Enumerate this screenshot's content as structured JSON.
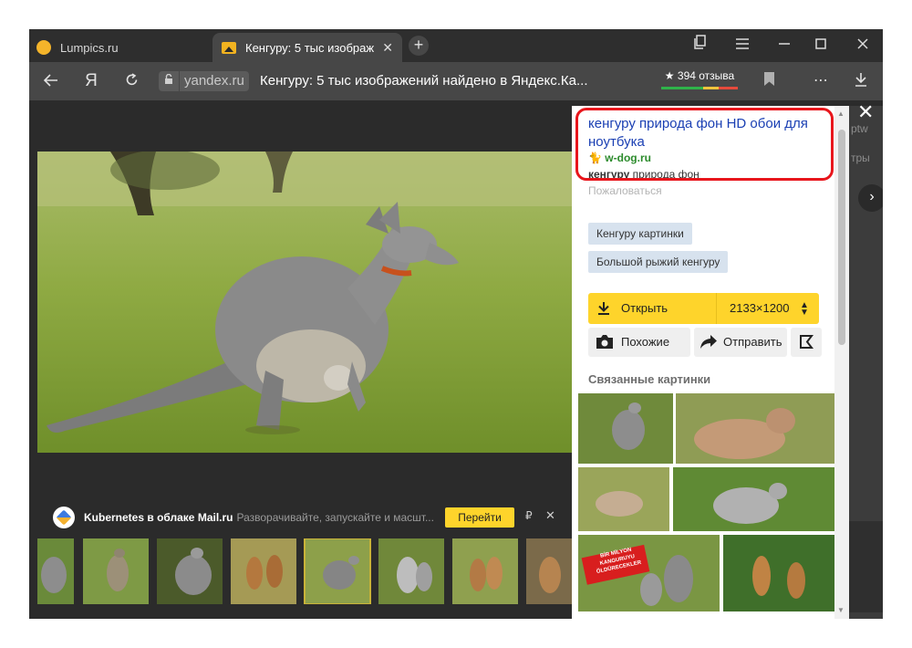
{
  "tabs": [
    {
      "label": "Lumpics.ru",
      "active": false
    },
    {
      "label": "Кенгуру: 5 тыс изображ",
      "active": true
    }
  ],
  "window_controls": {
    "minimize": "—",
    "maximize": "☐",
    "close": "✕"
  },
  "address_bar": {
    "domain": "yandex.ru",
    "title": "Кенгуру: 5 тыс изображений найдено в Яндекс.Ка...",
    "reviews": "★ 394 отзыва"
  },
  "ad": {
    "title": "Kubernetes в облаке Mail.ru",
    "description": "Разворачивайте, запускайте и масшт...",
    "button": "Перейти",
    "ruble": "₽"
  },
  "result": {
    "title": "кенгуру природа фон HD обои для ноутбука",
    "source": "w-dog.ru",
    "snippet_bold": "кенгуру",
    "snippet": " природа фон",
    "complain": "Пожаловаться"
  },
  "tags": [
    "Кенгуру картинки",
    "Большой рыжий кенгуру"
  ],
  "actions": {
    "open": "Открыть",
    "size": "2133×1200",
    "similar": "Похожие",
    "share": "Отправить"
  },
  "related_heading": "Связанные картинки",
  "related_badge": "BİR MİLYON KANGURUYU ÖLDÜRECEKLER",
  "behind_text": [
    "ptw",
    "тры"
  ],
  "colors": {
    "accent_yellow": "#fed42b",
    "link_blue": "#1a3fb3",
    "source_green": "#2c8b2c",
    "highlight_red": "#e8161c"
  }
}
